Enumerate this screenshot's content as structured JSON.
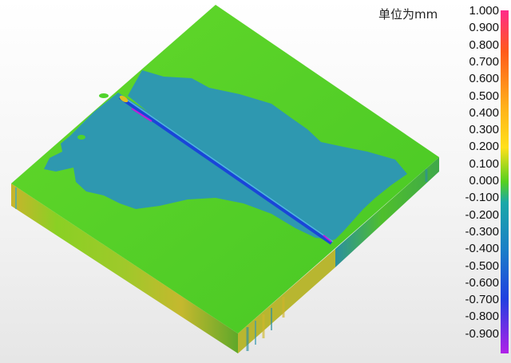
{
  "viewer": {
    "unit_label": "单位为mm",
    "colorbar": {
      "ticks": [
        "1.000",
        "0.900",
        "0.800",
        "0.700",
        "0.600",
        "0.500",
        "0.400",
        "0.300",
        "0.200",
        "0.100",
        "0.000",
        "-0.100",
        "-0.200",
        "-0.300",
        "-0.400",
        "-0.500",
        "-0.600",
        "-0.700",
        "-0.800",
        "-0.900"
      ],
      "colors": {
        "max": "#ff2b8a",
        "high": "#ff8a1a",
        "mid_high": "#ffd21a",
        "zero": "#55d01e",
        "low": "#1a9bb0",
        "mid_low": "#2245d8",
        "min": "#b020e8"
      }
    },
    "scene": {
      "description_icon": "deviation-heatmap",
      "colors": {
        "green": "#4fd32a",
        "cyan": "#2e98b0",
        "edge": "#c8b22a",
        "side_dark": "#8aa21e"
      }
    }
  }
}
